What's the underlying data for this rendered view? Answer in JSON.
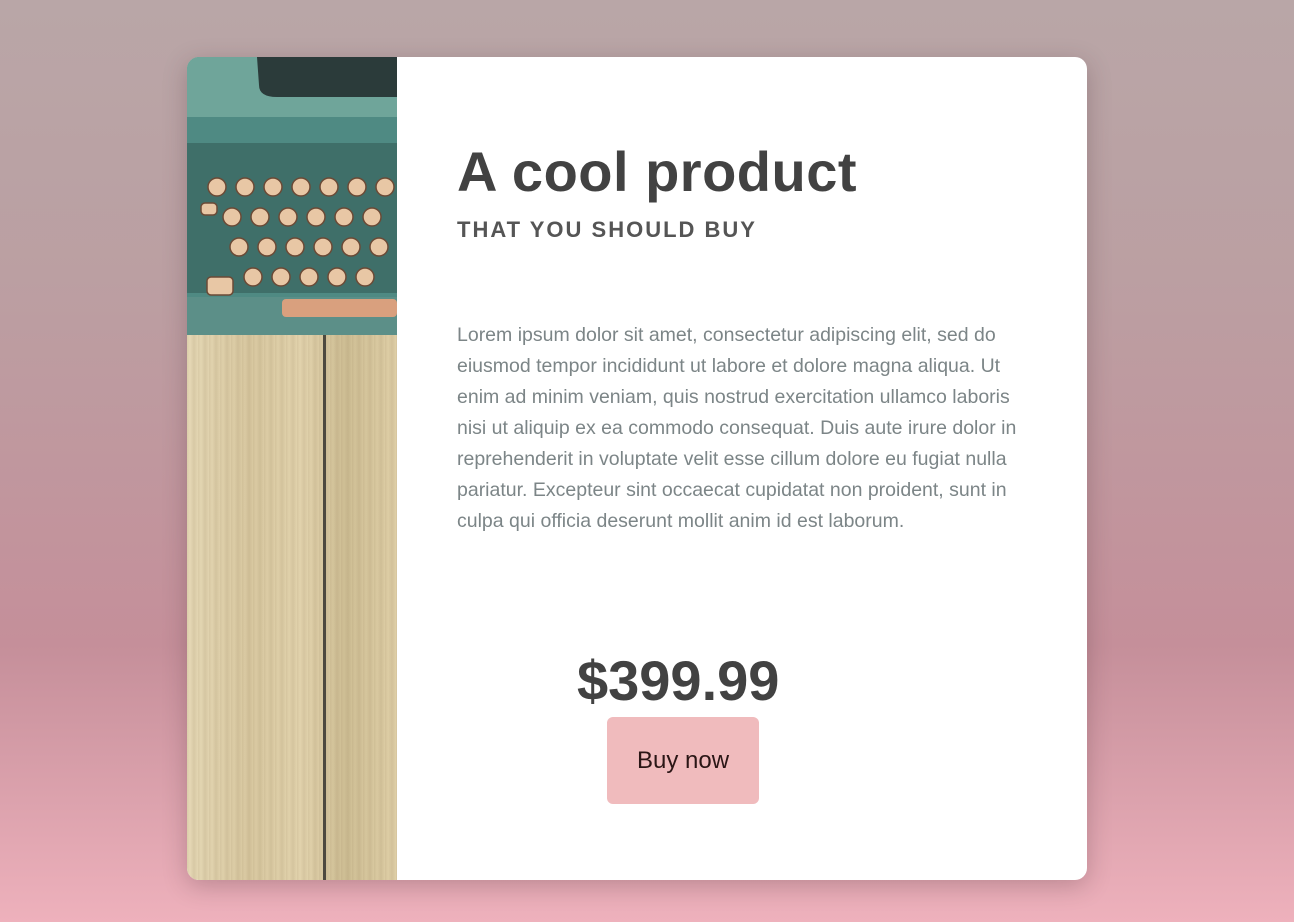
{
  "product": {
    "title": "A cool product",
    "subtitle": "THAT YOU SHOULD BUY",
    "description": "Lorem ipsum dolor sit amet, consectetur adipiscing elit, sed do eiusmod tempor incididunt ut labore et dolore magna aliqua. Ut enim ad minim veniam, quis nostrud exercitation ullamco laboris nisi ut aliquip ex ea commodo consequat. Duis aute irure dolor in reprehenderit in voluptate velit esse cillum dolore eu fugiat nulla pariatur. Excepteur sint occaecat cupidatat non proident, sunt in culpa qui officia deserunt mollit anim id est laborum.",
    "price": "$399.99",
    "buy_label": "Buy now",
    "image_icon": "typewriter-icon"
  },
  "colors": {
    "button": "#f0bbbd",
    "heading": "#424242",
    "body_text": "#7c8587"
  }
}
